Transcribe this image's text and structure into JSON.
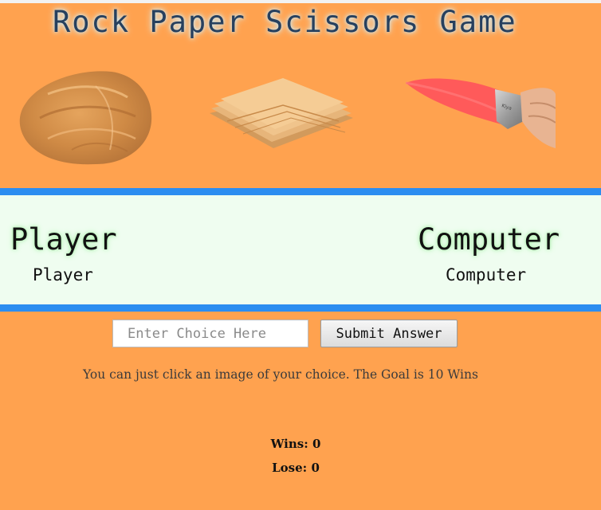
{
  "title": "Rock Paper Scissors Game",
  "choices": {
    "rock": {
      "icon": "rock-image"
    },
    "paper": {
      "icon": "paper-image"
    },
    "scissors": {
      "icon": "knife-image"
    }
  },
  "player": {
    "title": "Player",
    "choice": "Player"
  },
  "computer": {
    "title": "Computer",
    "choice": "Computer"
  },
  "input": {
    "placeholder": "Enter Choice Here",
    "value": ""
  },
  "submit_label": "Submit Answer",
  "instructions": "You can just click an image of your choice. The Goal is 10 Wins",
  "stats": {
    "wins_label": "Wins:",
    "wins": "0",
    "lose_label": "Lose:",
    "lose": "0"
  },
  "colors": {
    "background": "#FFA24F",
    "panel_border": "#2c8df0",
    "panel_background": "#effdf0",
    "title_text": "#27405e"
  }
}
